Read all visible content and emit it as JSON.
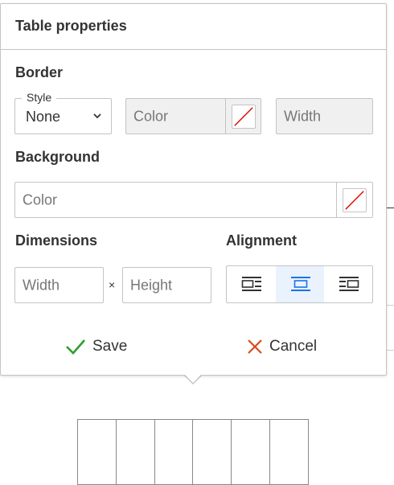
{
  "panel": {
    "title": "Table properties",
    "border": {
      "heading": "Border",
      "style_label": "Style",
      "style_value": "None",
      "color_placeholder": "Color",
      "width_placeholder": "Width"
    },
    "background": {
      "heading": "Background",
      "color_placeholder": "Color"
    },
    "dimensions": {
      "heading": "Dimensions",
      "width_placeholder": "Width",
      "separator": "×",
      "height_placeholder": "Height"
    },
    "alignment": {
      "heading": "Alignment",
      "options": [
        "align-left",
        "align-center",
        "align-right"
      ],
      "selected": "align-center"
    },
    "actions": {
      "save_label": "Save",
      "cancel_label": "Cancel"
    }
  },
  "colors": {
    "save_check": "#2e9e2e",
    "cancel_x": "#d84b1f",
    "no_color_slash": "#e00000",
    "active_alignment_bg": "#eaf2fd",
    "active_alignment_icon": "#1a73e8"
  },
  "icons": {
    "style_dropdown": "chevron-down-icon",
    "no_color": "no-color-swatch-icon",
    "save": "check-icon",
    "cancel": "close-icon"
  }
}
